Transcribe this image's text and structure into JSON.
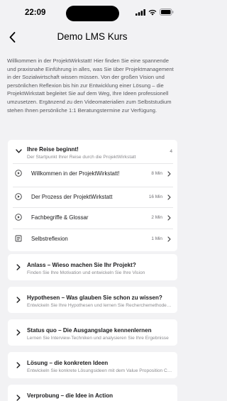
{
  "status_bar": {
    "time": "22:09"
  },
  "nav": {
    "title": "Demo LMS Kurs"
  },
  "intro": "Willkommen in der ProjektWirkstatt! Hier finden Sie eine spannende und praxisnahe Einführung in alles, was Sie über Projektmanagement in der Sozialwirtschaft wissen müssen. Von der großen Vision und persönlichen Reflexion bis hin zur Entwicklung einer Lösung – die ProjektWirkstatt begleitet Sie auf dem Weg, Ihre Ideen professionell umzusetzen. Ergänzend zu den Videomaterialien zum Selbststudium stehen Ihnen persönliche 1:1 Beratungstermine zur Verfügung.",
  "sections": [
    {
      "title": "Ihre Reise beginnt!",
      "subtitle": "Der Startpunkt Ihrer Reise durch die ProjektWirkstatt",
      "count": "4",
      "lessons": [
        {
          "label": "Willkommen in der ProjektWirkstatt!",
          "duration": "8 Min",
          "icon": "play-circle-icon"
        },
        {
          "label": "Der Prozess der ProjektWirkstatt",
          "duration": "16 Min",
          "icon": "play-circle-icon"
        },
        {
          "label": "Fachbegriffe & Glossar",
          "duration": "2 Min",
          "icon": "play-circle-icon"
        },
        {
          "label": "Selbstreflexion",
          "duration": "1 Min",
          "icon": "document-icon"
        }
      ]
    },
    {
      "title": "Anlass – Wieso machen Sie Ihr Projekt?",
      "subtitle": "Finden Sie Ihre Motivation und entwickeln Sie Ihre Vision"
    },
    {
      "title": "Hypothesen – Was glauben Sie schon zu wissen?",
      "subtitle": "Entwickeln Sie Ihre Hypothesen und lernen Sie Recherchemethoden kennen"
    },
    {
      "title": "Status quo – Die Ausgangslage kennenlernen",
      "subtitle": "Lernen Sie Interview-Techniken und analysieren Sie Ihre Ergebnisse"
    },
    {
      "title": "Lösung – die konkreten Ideen",
      "subtitle": "Entwickeln Sie konkrete Lösungsideen mit dem Value Proposition Canvas"
    },
    {
      "title": "Verprobung – die Idee in Action",
      "subtitle": ""
    }
  ]
}
